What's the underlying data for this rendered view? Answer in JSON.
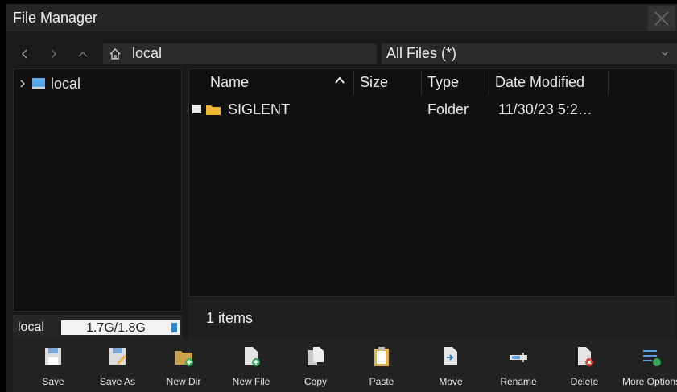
{
  "window": {
    "title": "File Manager"
  },
  "nav": {
    "path": "local",
    "filter": "All Files (*)"
  },
  "tree": {
    "items": [
      {
        "label": "local"
      }
    ]
  },
  "storage": {
    "label": "local",
    "usage": "1.7G/1.8G",
    "used_fraction": 0.05
  },
  "files": {
    "columns": [
      "Name",
      "Size",
      "Type",
      "Date Modified"
    ],
    "sort_column": "Name",
    "rows": [
      {
        "name": "SIGLENT",
        "size": "",
        "type": "Folder",
        "date": "11/30/23 5:2…"
      }
    ]
  },
  "status": {
    "count_text": "1 items"
  },
  "toolbar": {
    "buttons": [
      {
        "label": "Save"
      },
      {
        "label": "Save As"
      },
      {
        "label": "New Dir"
      },
      {
        "label": "New File"
      },
      {
        "label": "Copy"
      },
      {
        "label": "Paste"
      },
      {
        "label": "Move"
      },
      {
        "label": "Rename"
      },
      {
        "label": "Delete"
      },
      {
        "label": "More Options"
      }
    ]
  },
  "colors": {
    "accent": "#1e88d6",
    "folder": "#f2b632",
    "window": "#1a1a1a"
  }
}
